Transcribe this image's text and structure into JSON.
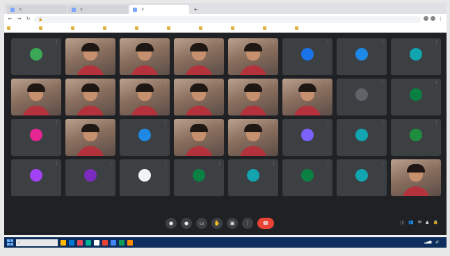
{
  "browser": {
    "tabs": [
      {
        "label": "",
        "active": false
      },
      {
        "label": "",
        "active": false
      },
      {
        "label": "",
        "active": true
      }
    ],
    "new_tab_glyph": "+",
    "omnibox_text": "",
    "bookmarks": [
      "",
      "",
      "",
      "",
      "",
      "",
      "",
      "",
      "",
      ""
    ]
  },
  "meet": {
    "meeting_title": "",
    "tiles": [
      {
        "type": "avatar",
        "color": "#3aa757",
        "initial": ""
      },
      {
        "type": "video"
      },
      {
        "type": "video"
      },
      {
        "type": "video"
      },
      {
        "type": "video"
      },
      {
        "type": "avatar",
        "color": "#1a73e8",
        "initial": ""
      },
      {
        "type": "avatar",
        "color": "#1e88e5",
        "initial": ""
      },
      {
        "type": "avatar",
        "color": "#12a4af",
        "initial": ""
      },
      {
        "type": "video"
      },
      {
        "type": "video"
      },
      {
        "type": "video"
      },
      {
        "type": "video"
      },
      {
        "type": "video"
      },
      {
        "type": "video"
      },
      {
        "type": "avatar",
        "color": "#5f6368",
        "initial": ""
      },
      {
        "type": "avatar",
        "color": "#0b8043",
        "initial": ""
      },
      {
        "type": "avatar",
        "color": "#e52592",
        "initial": ""
      },
      {
        "type": "video"
      },
      {
        "type": "avatar",
        "color": "#1e88e5",
        "initial": ""
      },
      {
        "type": "video"
      },
      {
        "type": "video"
      },
      {
        "type": "avatar",
        "color": "#7b61ff",
        "initial": ""
      },
      {
        "type": "avatar",
        "color": "#12a4af",
        "initial": ""
      },
      {
        "type": "avatar",
        "color": "#1e8e3e",
        "initial": ""
      },
      {
        "type": "avatar",
        "color": "#a142f4",
        "initial": ""
      },
      {
        "type": "avatar",
        "color": "#7b2cbf",
        "initial": ""
      },
      {
        "type": "avatar",
        "color": "#f1f3f4",
        "initial": ""
      },
      {
        "type": "avatar",
        "color": "#0b8043",
        "initial": ""
      },
      {
        "type": "avatar",
        "color": "#12a4af",
        "initial": ""
      },
      {
        "type": "avatar",
        "color": "#0b8043",
        "initial": ""
      },
      {
        "type": "avatar",
        "color": "#12a4af",
        "initial": ""
      },
      {
        "type": "video"
      }
    ],
    "controls": [
      {
        "icon": "mic-icon",
        "glyph": "●"
      },
      {
        "icon": "camera-icon",
        "glyph": "●"
      },
      {
        "icon": "captions-icon",
        "glyph": "▭"
      },
      {
        "icon": "raise-hand-icon",
        "glyph": "✋"
      },
      {
        "icon": "present-icon",
        "glyph": "▣"
      },
      {
        "icon": "more-options-icon",
        "glyph": "⋮"
      },
      {
        "icon": "end-call-icon",
        "glyph": "☎"
      }
    ],
    "right_controls": [
      {
        "icon": "info-icon",
        "glyph": "ⓘ"
      },
      {
        "icon": "people-icon",
        "glyph": "👥"
      },
      {
        "icon": "chat-icon",
        "glyph": "✉"
      },
      {
        "icon": "activities-icon",
        "glyph": "▲"
      },
      {
        "icon": "lock-icon",
        "glyph": "🔒"
      }
    ]
  },
  "taskbar": {
    "search_placeholder": "",
    "apps": [
      "#ffb900",
      "#0078d4",
      "#e74856",
      "#00b294",
      "#ffffff",
      "#ea4335",
      "#4285f4",
      "#0f9d58",
      "#ff8c00"
    ],
    "clock": ""
  }
}
